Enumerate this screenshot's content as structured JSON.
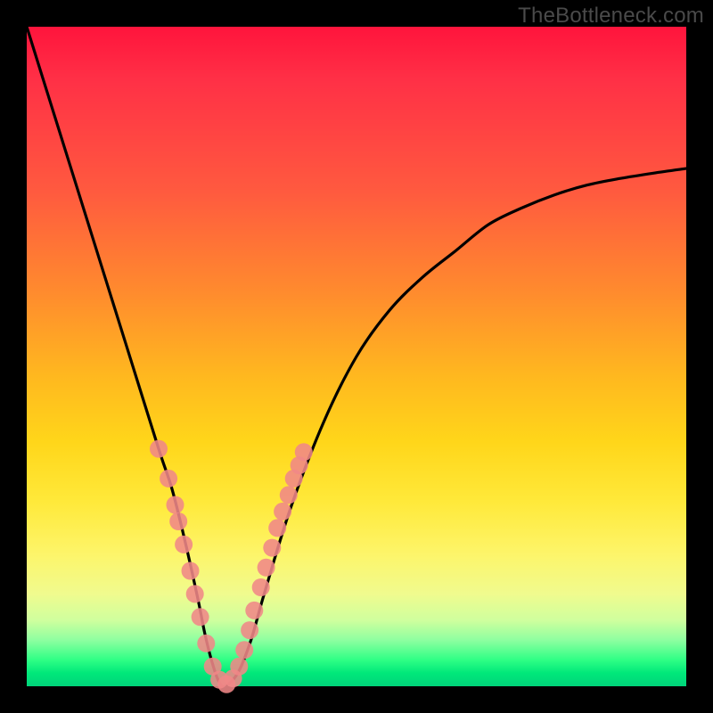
{
  "watermark": "TheBottleneck.com",
  "chart_data": {
    "type": "line",
    "title": "",
    "xlabel": "",
    "ylabel": "",
    "xlim": [
      0,
      100
    ],
    "ylim": [
      0,
      100
    ],
    "grid": false,
    "legend": false,
    "series": [
      {
        "name": "bottleneck-curve",
        "color": "#000000",
        "x": [
          0,
          5,
          10,
          15,
          20,
          22,
          24,
          26,
          27,
          28,
          29,
          30,
          32,
          34,
          36,
          40,
          45,
          50,
          55,
          60,
          65,
          70,
          75,
          80,
          85,
          90,
          95,
          100
        ],
        "values": [
          100,
          84,
          68,
          52,
          36,
          30,
          22,
          13,
          8,
          4,
          1,
          0,
          2,
          7,
          14,
          27,
          40,
          50,
          57,
          62,
          66,
          70,
          72.5,
          74.5,
          76,
          77,
          77.8,
          78.5
        ]
      }
    ],
    "markers": {
      "name": "highlighted-points",
      "color": "#f08887",
      "radius_px": 10,
      "points": [
        {
          "x": 20.0,
          "y": 36.0
        },
        {
          "x": 21.5,
          "y": 31.5
        },
        {
          "x": 22.5,
          "y": 27.5
        },
        {
          "x": 23.0,
          "y": 25.0
        },
        {
          "x": 23.8,
          "y": 21.5
        },
        {
          "x": 24.8,
          "y": 17.5
        },
        {
          "x": 25.5,
          "y": 14.0
        },
        {
          "x": 26.3,
          "y": 10.5
        },
        {
          "x": 27.2,
          "y": 6.5
        },
        {
          "x": 28.2,
          "y": 3.0
        },
        {
          "x": 29.2,
          "y": 1.0
        },
        {
          "x": 30.3,
          "y": 0.3
        },
        {
          "x": 31.3,
          "y": 1.2
        },
        {
          "x": 32.2,
          "y": 3.0
        },
        {
          "x": 33.0,
          "y": 5.5
        },
        {
          "x": 33.8,
          "y": 8.5
        },
        {
          "x": 34.5,
          "y": 11.5
        },
        {
          "x": 35.5,
          "y": 15.0
        },
        {
          "x": 36.3,
          "y": 18.0
        },
        {
          "x": 37.2,
          "y": 21.0
        },
        {
          "x": 38.0,
          "y": 24.0
        },
        {
          "x": 38.8,
          "y": 26.5
        },
        {
          "x": 39.7,
          "y": 29.0
        },
        {
          "x": 40.5,
          "y": 31.5
        },
        {
          "x": 41.3,
          "y": 33.5
        },
        {
          "x": 42.0,
          "y": 35.5
        }
      ]
    }
  }
}
